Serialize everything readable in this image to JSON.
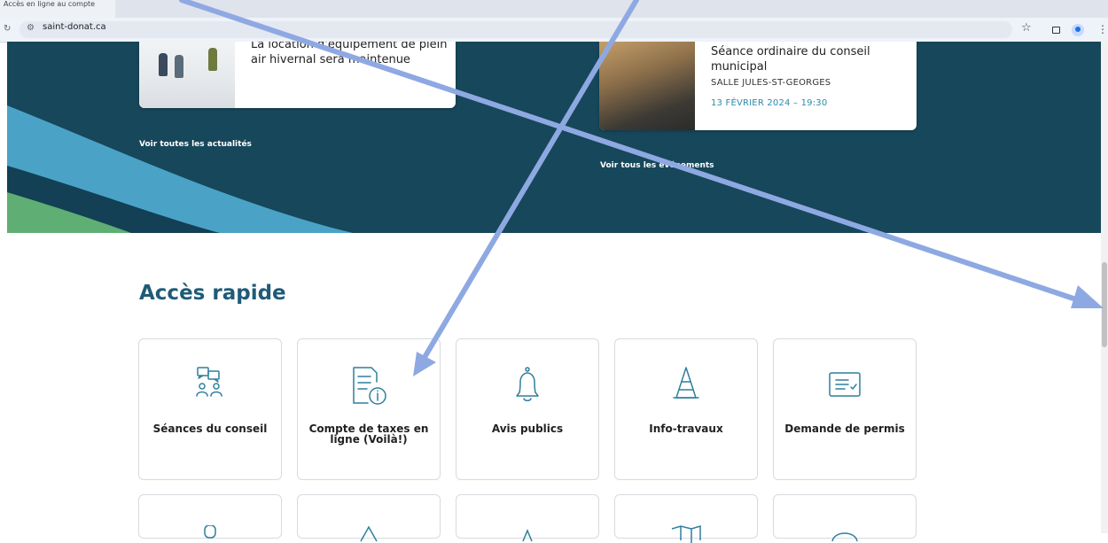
{
  "browser": {
    "tab_title": "Accès en ligne au compte",
    "url": "saint-donat.ca"
  },
  "news": {
    "card_title": "La location d'équipement de plein air hivernal sera maintenue",
    "all_link": "Voir toutes les actualités"
  },
  "events": {
    "card_title": "Séance ordinaire du conseil municipal",
    "place": "SALLE JULES-ST-GEORGES",
    "date": "13 FÉVRIER 2024 – 19:30",
    "all_link": "Voir tous les événements"
  },
  "quick_access": {
    "title": "Accès rapide",
    "tiles": [
      {
        "label": "Séances du conseil",
        "icon": "council-meeting-icon"
      },
      {
        "label": "Compte de taxes en ligne (Voilà!)",
        "icon": "tax-document-info-icon"
      },
      {
        "label": "Avis publics",
        "icon": "bell-icon"
      },
      {
        "label": "Info-travaux",
        "icon": "traffic-cone-icon"
      },
      {
        "label": "Demande de permis",
        "icon": "permit-form-icon"
      }
    ]
  },
  "colors": {
    "hero_background": "#17475a",
    "title_color": "#1f5b78",
    "icon_color": "#2f7f9d",
    "annotation_arrow": "#8ea9e2"
  }
}
